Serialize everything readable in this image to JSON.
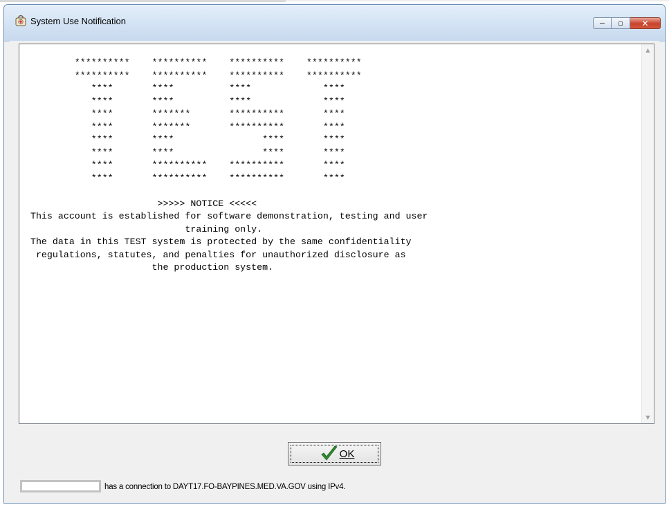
{
  "window": {
    "title": "System Use Notification"
  },
  "caption_buttons": {
    "minimize": "−",
    "maximize": "▫",
    "close": "✕"
  },
  "notice": {
    "text": "          **********    **********    **********    **********\n          **********    **********    **********    **********\n             ****       ****          ****             ****\n             ****       ****          ****             ****\n             ****       *******       **********       ****\n             ****       *******       **********       ****\n             ****       ****                ****       ****\n             ****       ****                ****       ****\n             ****       **********    **********       ****\n             ****       **********    **********       ****\n\n                         >>>>> NOTICE <<<<<\n  This account is established for software demonstration, testing and user\n                              training only.\n  The data in this TEST system is protected by the same confidentiality\n   regulations, statutes, and penalties for unauthorized disclosure as\n                        the production system."
  },
  "scrollbar": {
    "up_icon": "scroll-up-arrow",
    "down_icon": "scroll-down-arrow"
  },
  "ok_button": {
    "label": "OK",
    "icon": "checkmark-icon",
    "color": "#2e8b2e"
  },
  "status": {
    "field_value": "",
    "message": "has a connection to DAYT17.FO-BAYPINES.MED.VA.GOV using IPv4."
  },
  "colors": {
    "titlebar": "#d6e5f5",
    "close_button": "#c8422c",
    "window_bg": "#f0f0f0"
  }
}
